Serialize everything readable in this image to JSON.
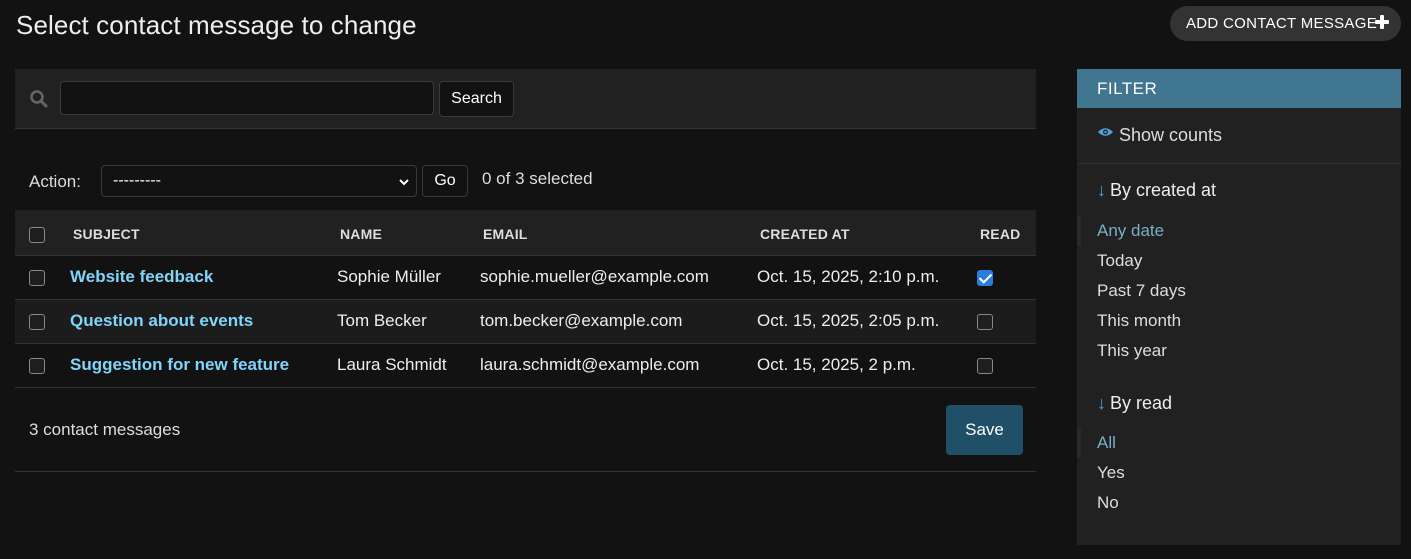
{
  "page": {
    "title": "Select contact message to change",
    "add_button_label": "ADD CONTACT MESSAGE"
  },
  "search": {
    "value": "",
    "button_label": "Search"
  },
  "actions": {
    "label": "Action:",
    "selected_option": "---------",
    "go_label": "Go",
    "selected_count_text": "0 of 3 selected"
  },
  "table": {
    "columns": [
      "SUBJECT",
      "NAME",
      "EMAIL",
      "CREATED AT",
      "READ"
    ],
    "rows": [
      {
        "subject": "Website feedback",
        "name": "Sophie Müller",
        "email": "sophie.mueller@example.com",
        "created_at": "Oct. 15, 2025, 2:10 p.m.",
        "read": true
      },
      {
        "subject": "Question about events",
        "name": "Tom Becker",
        "email": "tom.becker@example.com",
        "created_at": "Oct. 15, 2025, 2:05 p.m.",
        "read": false
      },
      {
        "subject": "Suggestion for new feature",
        "name": "Laura Schmidt",
        "email": "laura.schmidt@example.com",
        "created_at": "Oct. 15, 2025, 2 p.m.",
        "read": false
      }
    ]
  },
  "footer": {
    "count_text": "3 contact messages",
    "save_label": "Save"
  },
  "filter": {
    "title": "FILTER",
    "show_counts_label": "Show counts",
    "sections": [
      {
        "title": "By created at",
        "arrow": "↓",
        "options": [
          "Any date",
          "Today",
          "Past 7 days",
          "This month",
          "This year"
        ],
        "selected": "Any date"
      },
      {
        "title": "By read",
        "arrow": "↓",
        "options": [
          "All",
          "Yes",
          "No"
        ],
        "selected": "All"
      }
    ]
  },
  "colors": {
    "background": "#121212",
    "accent_link": "#81d4fa",
    "filter_header": "#417690",
    "save_button": "#205067",
    "selected_filter": "#79aec8"
  },
  "icons": [
    "plus-icon",
    "search-icon",
    "chevron-down-icon",
    "eye-icon",
    "checkbox-icon"
  ]
}
